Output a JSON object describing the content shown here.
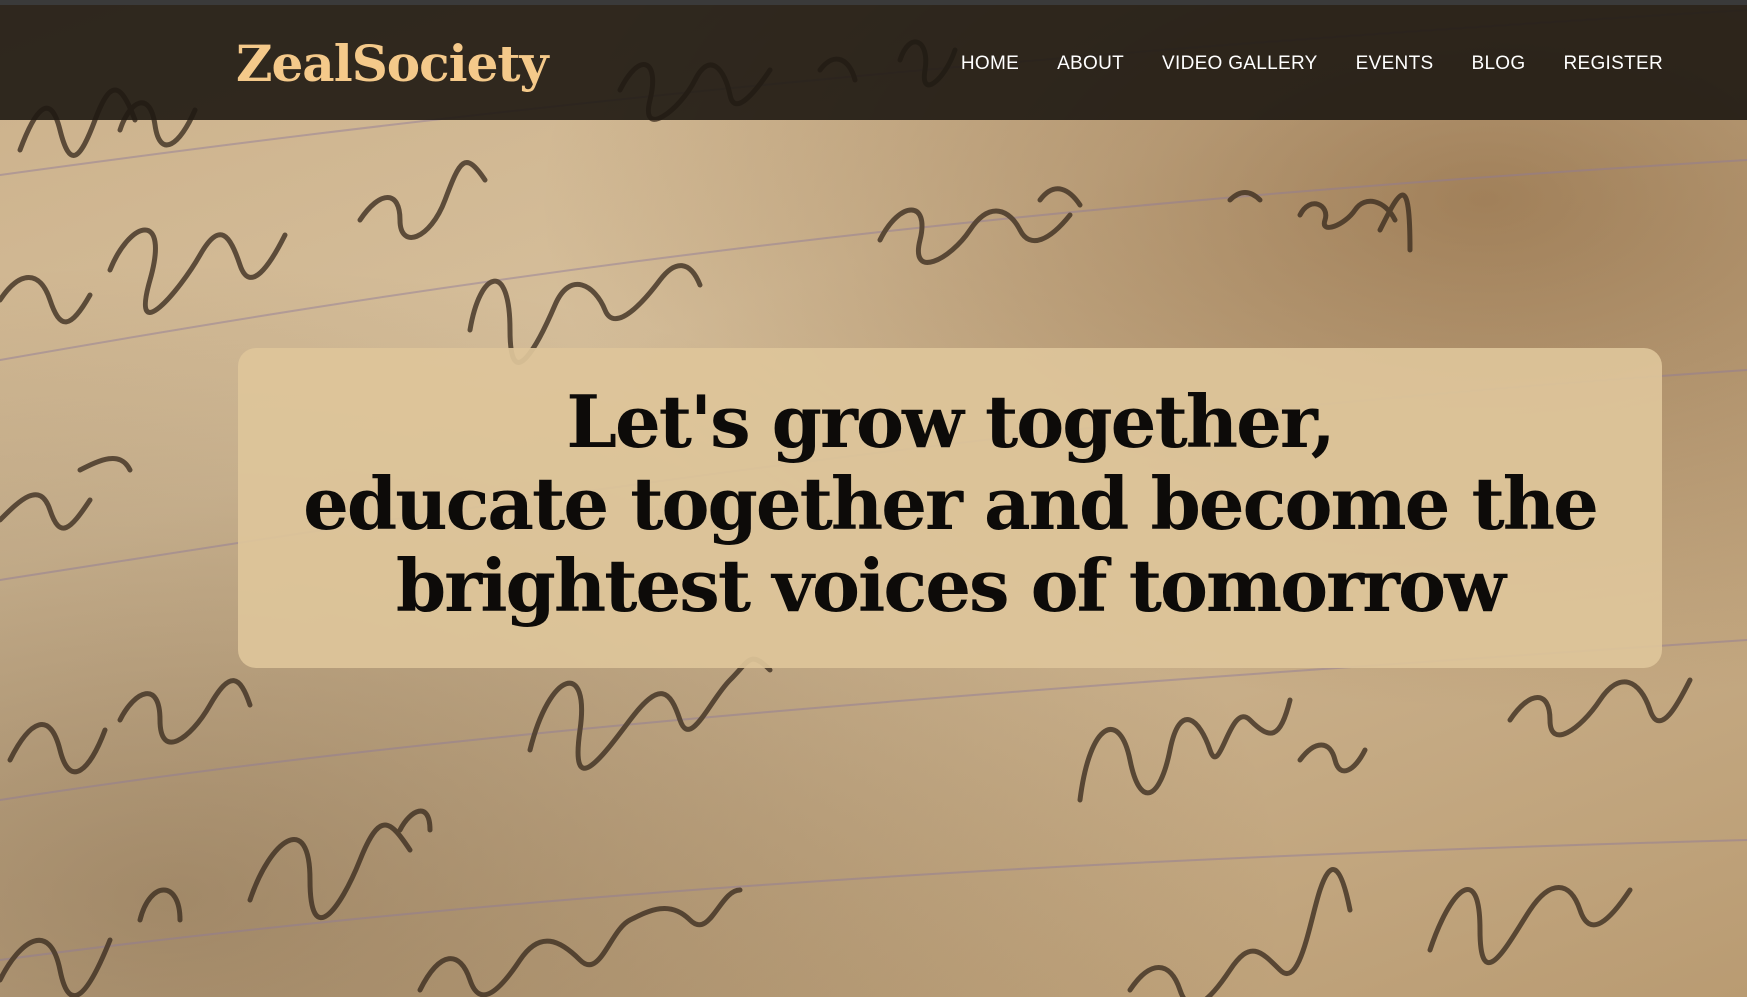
{
  "brand": {
    "name": "ZealSociety",
    "color": "#f4c98a"
  },
  "nav": {
    "items": [
      {
        "label": "HOME"
      },
      {
        "label": "ABOUT"
      },
      {
        "label": "VIDEO GALLERY"
      },
      {
        "label": "EVENTS"
      },
      {
        "label": "BLOG"
      },
      {
        "label": "REGISTER"
      }
    ]
  },
  "hero": {
    "lines": [
      "Let's grow together,",
      "educate together and become the",
      "brightest voices of tomorrow"
    ],
    "background_image": "aged-handwritten-letter-photo",
    "card_color": "#dec59a",
    "text_color": "#0d0b09"
  }
}
